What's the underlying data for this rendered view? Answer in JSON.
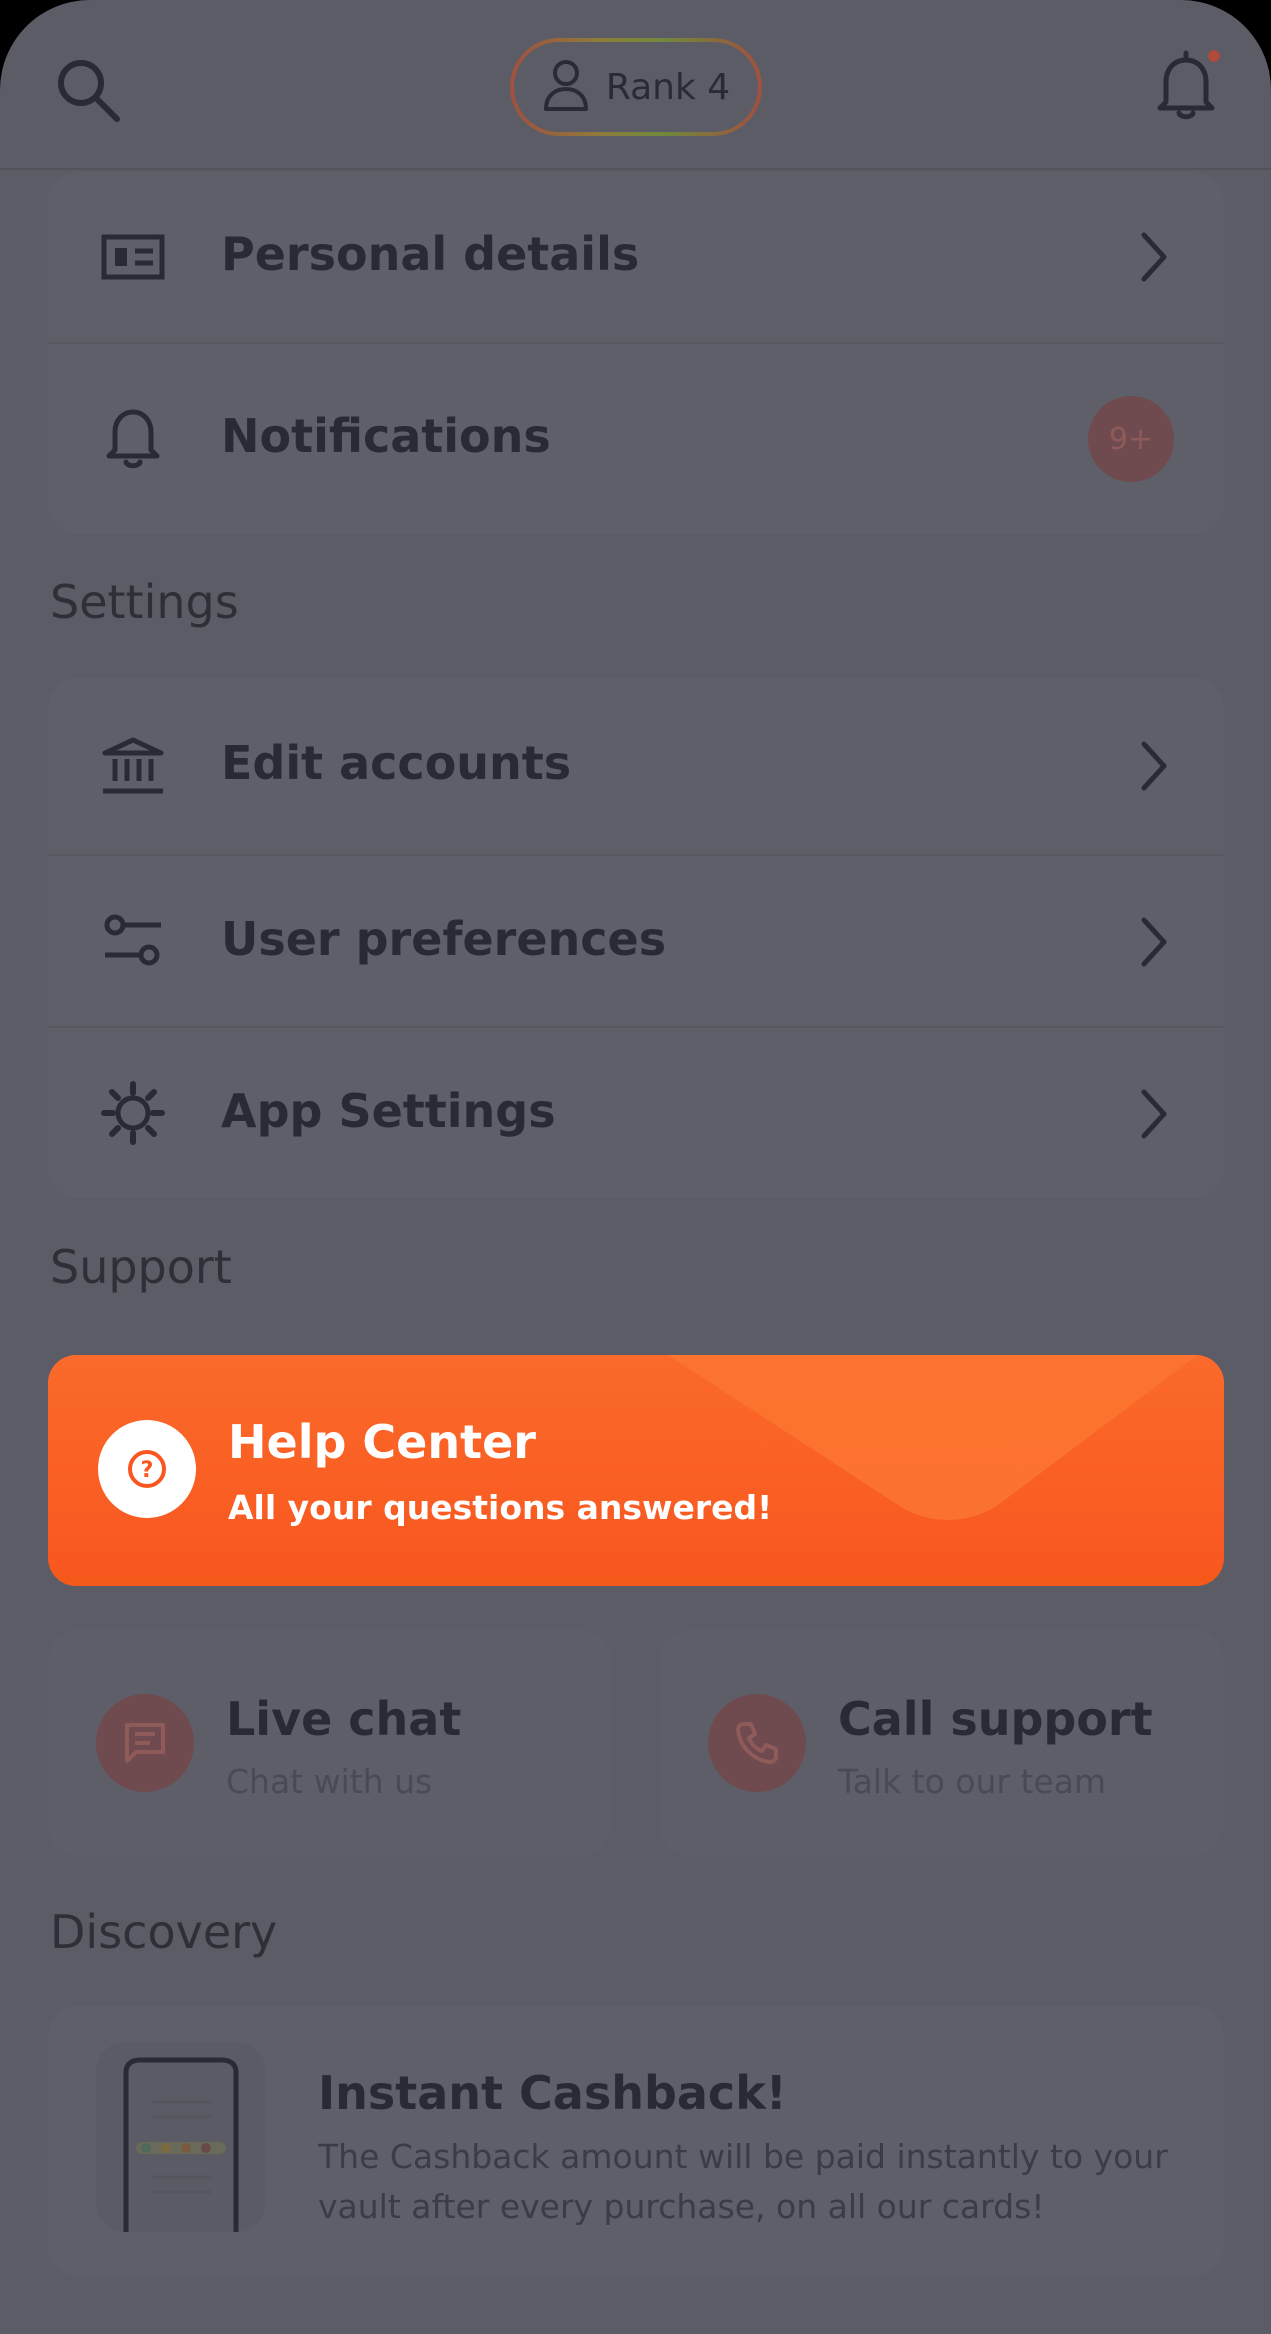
{
  "header": {
    "rank_label": "Rank 4"
  },
  "account": {
    "items": [
      {
        "label": "Personal details"
      },
      {
        "label": "Notifications",
        "badge": "9+"
      }
    ]
  },
  "settings": {
    "title": "Settings",
    "items": [
      {
        "label": "Edit accounts"
      },
      {
        "label": "User preferences"
      },
      {
        "label": "App Settings"
      }
    ]
  },
  "support": {
    "title": "Support",
    "help_center": {
      "title": "Help Center",
      "subtitle": "All your questions answered!"
    },
    "live_chat": {
      "title": "Live chat",
      "subtitle": "Chat with us"
    },
    "call_support": {
      "title": "Call support",
      "subtitle": "Talk to our team"
    }
  },
  "discovery": {
    "title": "Discovery",
    "promo": {
      "title": "Instant Cashback!",
      "text": "The Cashback amount will be paid instantly to your vault after every purchase, on all our cards!"
    }
  },
  "colors": {
    "accent": "#f9571f",
    "overlay": "#5c5c66"
  }
}
